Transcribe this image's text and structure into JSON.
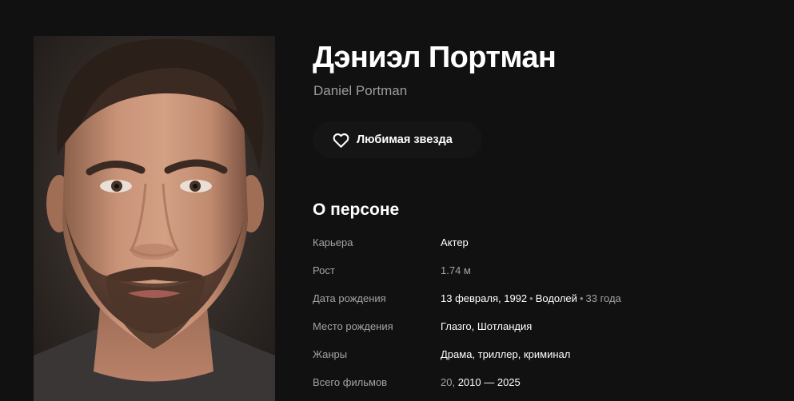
{
  "person": {
    "name": "Дэниэл Портман",
    "original_name": "Daniel Portman"
  },
  "actions": {
    "favorite_label": "Любимая звезда",
    "favorite_icon": "heart-outline-icon"
  },
  "about": {
    "title": "О персоне",
    "career": {
      "label": "Карьера",
      "value": "Актер"
    },
    "height": {
      "label": "Рост",
      "value": "1.74 м"
    },
    "birth": {
      "label": "Дата рождения",
      "date": "13 февраля, 1992",
      "sign": "Водолей",
      "age": "33 года"
    },
    "birthplace": {
      "label": "Место рождения",
      "value": "Глазго, Шотландия"
    },
    "genres": {
      "label": "Жанры",
      "value": "Драма, триллер, криминал"
    },
    "films": {
      "label": "Всего фильмов",
      "count": "20,",
      "range": "2010 — 2025"
    }
  },
  "colors": {
    "background": "#111112",
    "text": "#ffffff",
    "muted": "#a3a3a5"
  }
}
